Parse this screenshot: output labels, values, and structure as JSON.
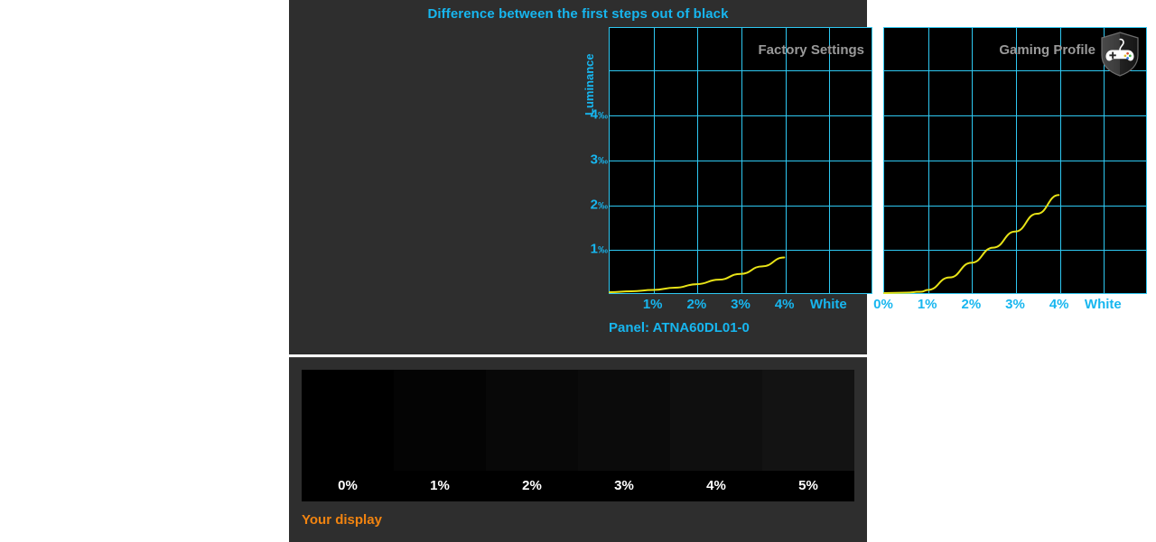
{
  "top_panel": {
    "title": "Difference between the first steps out of black",
    "y_axis_title": "Luminance",
    "panel_label": "Panel: ATNA60DL01-0"
  },
  "bottom_panel": {
    "caption": "Your display",
    "band_labels": [
      "0%",
      "1%",
      "2%",
      "3%",
      "4%",
      "5%"
    ],
    "band_colors": [
      "#000000",
      "#040404",
      "#080808",
      "#0b0b0b",
      "#0f0f0f",
      "#131313"
    ]
  },
  "colors": {
    "accent_cyan": "#17b6ef",
    "grid_cyan": "#2ec8f2",
    "curve_yellow": "#e8e317",
    "panel_bg": "#2e2e2e",
    "plot_bg": "#000000",
    "label_gray": "#9a9a9a",
    "caption_orange": "#f28410"
  },
  "icons": {
    "gaming_badge": "shield-gamepad-icon"
  },
  "chart_data": [
    {
      "type": "line",
      "title": "Factory Settings",
      "xlabel": "",
      "ylabel": "Luminance",
      "x_tick_labels": [
        "1%",
        "2%",
        "3%",
        "4%",
        "White"
      ],
      "x_tick_positions": [
        1,
        2,
        3,
        4,
        5
      ],
      "y_tick_labels": [
        "1‰",
        "2‰",
        "3‰",
        "4‰"
      ],
      "y_ticks": [
        1,
        2,
        3,
        4
      ],
      "xlim": [
        0,
        6
      ],
      "ylim": [
        0,
        5.95
      ],
      "grid": true,
      "legend": "Factory Settings",
      "series": [
        {
          "name": "Factory Settings",
          "color": "#e8e317",
          "x": [
            0,
            0.5,
            1,
            1.5,
            2,
            2.5,
            3,
            3.5,
            4
          ],
          "values": [
            0.02,
            0.04,
            0.07,
            0.12,
            0.2,
            0.3,
            0.43,
            0.6,
            0.8
          ]
        }
      ]
    },
    {
      "type": "line",
      "title": "Gaming Profile",
      "xlabel": "",
      "ylabel": "Luminance",
      "x_tick_labels": [
        "0%",
        "1%",
        "2%",
        "3%",
        "4%",
        "White"
      ],
      "x_tick_positions": [
        0,
        1,
        2,
        3,
        4,
        5
      ],
      "y_tick_labels": [
        "1‰",
        "2‰",
        "3‰",
        "4‰"
      ],
      "y_ticks": [
        1,
        2,
        3,
        4
      ],
      "xlim": [
        0,
        6
      ],
      "ylim": [
        0,
        5.95
      ],
      "grid": true,
      "legend": "Gaming Profile",
      "series": [
        {
          "name": "Gaming Profile",
          "color": "#e8e317",
          "x": [
            0,
            0.5,
            0.85,
            1,
            1.5,
            2,
            2.5,
            3,
            3.5,
            4
          ],
          "values": [
            0.0,
            0.01,
            0.03,
            0.07,
            0.35,
            0.68,
            1.02,
            1.38,
            1.78,
            2.2
          ]
        }
      ]
    }
  ]
}
